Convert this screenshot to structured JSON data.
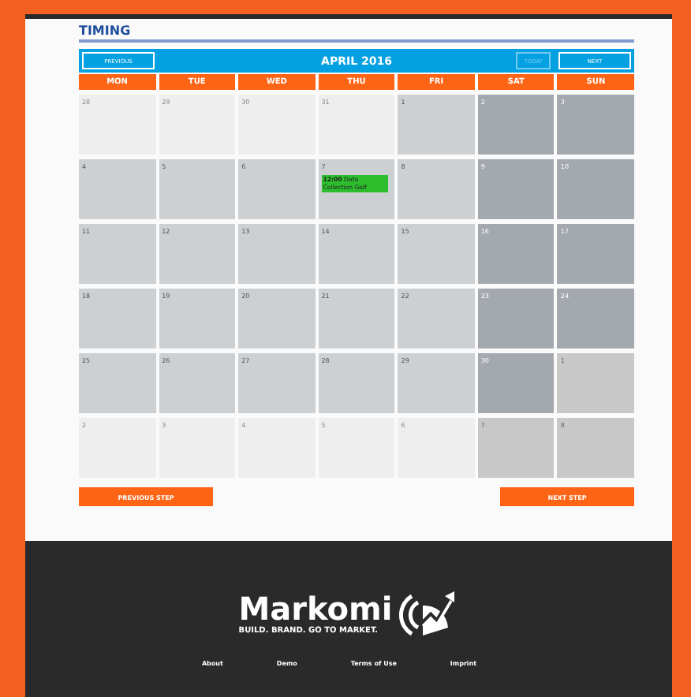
{
  "section_title": "TIMING",
  "calendar": {
    "title": "APRIL 2016",
    "buttons": [
      {
        "label": "PREVIOUS",
        "kind": "prev",
        "disabled": false
      },
      {
        "label": "TODAY",
        "kind": "today",
        "disabled": true
      },
      {
        "label": "NEXT",
        "kind": "next",
        "disabled": false
      }
    ],
    "weekdays": [
      "MON",
      "TUE",
      "WED",
      "THU",
      "FRI",
      "SAT",
      "SUN"
    ],
    "weeks": [
      [
        {
          "day": "28",
          "kind": "outside"
        },
        {
          "day": "29",
          "kind": "outside"
        },
        {
          "day": "30",
          "kind": "outside"
        },
        {
          "day": "31",
          "kind": "outside"
        },
        {
          "day": "1",
          "kind": "weekday"
        },
        {
          "day": "2",
          "kind": "weekend"
        },
        {
          "day": "3",
          "kind": "weekend"
        }
      ],
      [
        {
          "day": "4",
          "kind": "weekday"
        },
        {
          "day": "5",
          "kind": "weekday"
        },
        {
          "day": "6",
          "kind": "weekday"
        },
        {
          "day": "7",
          "kind": "weekday",
          "events": [
            {
              "text": "**12:00** Data Collection Golf",
              "color": "#2dbd2d"
            }
          ]
        },
        {
          "day": "8",
          "kind": "weekday"
        },
        {
          "day": "9",
          "kind": "weekend"
        },
        {
          "day": "10",
          "kind": "weekend"
        }
      ],
      [
        {
          "day": "11",
          "kind": "weekday"
        },
        {
          "day": "12",
          "kind": "weekday"
        },
        {
          "day": "13",
          "kind": "weekday"
        },
        {
          "day": "14",
          "kind": "weekday"
        },
        {
          "day": "15",
          "kind": "weekday"
        },
        {
          "day": "16",
          "kind": "weekend"
        },
        {
          "day": "17",
          "kind": "weekend"
        }
      ],
      [
        {
          "day": "18",
          "kind": "weekday"
        },
        {
          "day": "19",
          "kind": "weekday"
        },
        {
          "day": "20",
          "kind": "weekday"
        },
        {
          "day": "21",
          "kind": "weekday"
        },
        {
          "day": "22",
          "kind": "weekday"
        },
        {
          "day": "23",
          "kind": "weekend"
        },
        {
          "day": "24",
          "kind": "weekend"
        }
      ],
      [
        {
          "day": "25",
          "kind": "weekday"
        },
        {
          "day": "26",
          "kind": "weekday"
        },
        {
          "day": "27",
          "kind": "weekday"
        },
        {
          "day": "28",
          "kind": "weekday"
        },
        {
          "day": "29",
          "kind": "weekday"
        },
        {
          "day": "30",
          "kind": "weekend"
        },
        {
          "day": "1",
          "kind": "outside-weekend"
        }
      ],
      [
        {
          "day": "2",
          "kind": "outside"
        },
        {
          "day": "3",
          "kind": "outside"
        },
        {
          "day": "4",
          "kind": "outside"
        },
        {
          "day": "5",
          "kind": "outside"
        },
        {
          "day": "6",
          "kind": "outside"
        },
        {
          "day": "7",
          "kind": "outside-weekend"
        },
        {
          "day": "8",
          "kind": "outside-weekend"
        }
      ]
    ]
  },
  "steps": {
    "previous": "PREVIOUS STEP",
    "next": "NEXT STEP"
  },
  "footer": {
    "logo": "Markomi",
    "tagline": "BUILD. BRAND. GO TO MARKET.",
    "links": [
      "About",
      "Demo",
      "Terms of Use",
      "Imprint"
    ]
  }
}
